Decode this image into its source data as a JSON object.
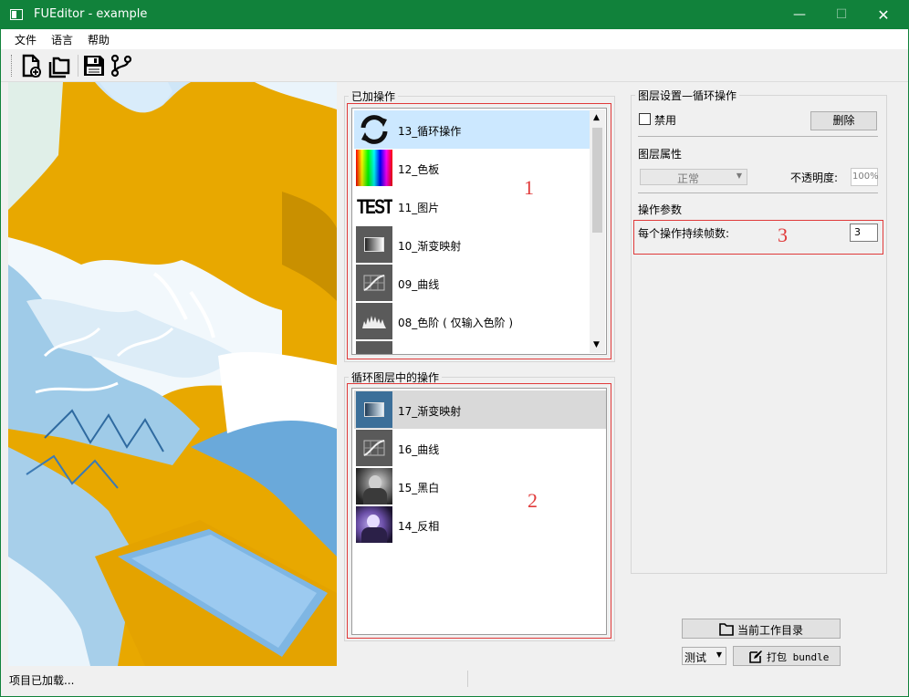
{
  "window": {
    "title": "FUEditor - example",
    "controls": {
      "minimize": "—",
      "maximize": "☐",
      "close": "✕"
    },
    "accent_color": "#11823b"
  },
  "menu": {
    "items": [
      "文件",
      "语言",
      "帮助"
    ]
  },
  "toolbar": {
    "buttons": [
      "new-file-icon",
      "open-folder-icon",
      "save-icon",
      "branch-icon"
    ]
  },
  "added_ops": {
    "group_title": "已加操作",
    "items": [
      {
        "label": "13_循环操作",
        "icon": "cycle-icon"
      },
      {
        "label": "12_色板",
        "icon": "palette-icon"
      },
      {
        "label": "11_图片",
        "icon": "image-icon",
        "icon_text": "TEST"
      },
      {
        "label": "10_渐变映射",
        "icon": "gradient-map-icon"
      },
      {
        "label": "09_曲线",
        "icon": "curves-icon"
      },
      {
        "label": "08_色阶 ( 仅输入色阶 )",
        "icon": "levels-icon"
      }
    ],
    "annotation": "1"
  },
  "loop_ops": {
    "group_title": "循环图层中的操作",
    "items": [
      {
        "label": "17_渐变映射",
        "icon": "gradient-map-icon"
      },
      {
        "label": "16_曲线",
        "icon": "curves-icon"
      },
      {
        "label": "15_黑白",
        "icon": "bw-photo-icon"
      },
      {
        "label": "14_反相",
        "icon": "invert-photo-icon"
      }
    ],
    "annotation": "2"
  },
  "layer_settings": {
    "group_title": "图层设置—循环操作",
    "disable_label": "禁用",
    "delete_label": "删除",
    "props_title": "图层属性",
    "blend_mode": "正常",
    "opacity_label": "不透明度:",
    "opacity_value": "100%",
    "params_title": "操作参数",
    "frames_label": "每个操作持续帧数:",
    "frames_value": "3",
    "annotation": "3"
  },
  "bottom": {
    "workdir_label": "当前工作目录",
    "mode_value": "测试",
    "pack_label": "打包 bundle"
  },
  "status": {
    "text": "项目已加载..."
  }
}
